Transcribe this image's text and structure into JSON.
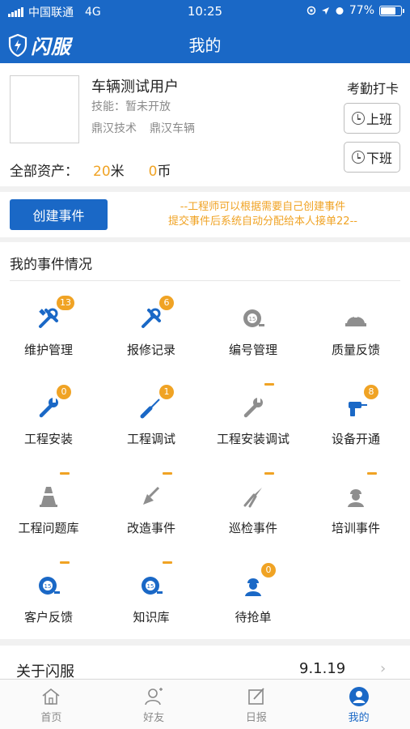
{
  "status_bar": {
    "carrier": "中国联通",
    "network": "4G",
    "time": "10:25",
    "battery": "77%",
    "battery_level": 0.77
  },
  "nav": {
    "logo_text": "闪服",
    "title": "我的"
  },
  "profile": {
    "name": "车辆测试用户",
    "skill": "技能：暂未开放",
    "orgs": [
      "鼎汉技术",
      "鼎汉车辆"
    ],
    "assets_label": "全部资产：",
    "meters_value": "20",
    "meters_unit": "米",
    "coins_value": "0",
    "coins_unit": "币",
    "attendance_label": "考勤打卡",
    "punch_in": "上班",
    "punch_out": "下班"
  },
  "create": {
    "button": "创建事件",
    "tip1": "--工程师可以根据需要自己创建事件",
    "tip2": "提交事件后系统自动分配给本人接单22--"
  },
  "events": {
    "title": "我的事件情况",
    "items": [
      {
        "label": "维护管理",
        "badge": "13",
        "icon": "tools-icon"
      },
      {
        "label": "报修记录",
        "badge": "6",
        "icon": "repair-icon"
      },
      {
        "label": "编号管理",
        "badge": "",
        "icon": "tape-measure-icon"
      },
      {
        "label": "质量反馈",
        "badge": "",
        "icon": "helmet-icon"
      },
      {
        "label": "工程安装",
        "badge": "0",
        "icon": "wrench-icon"
      },
      {
        "label": "工程调试",
        "badge": "1",
        "icon": "screwdriver-icon"
      },
      {
        "label": "工程安装调试",
        "badge": "—",
        "icon": "wrench-gray-icon"
      },
      {
        "label": "设备开通",
        "badge": "8",
        "icon": "drill-icon"
      },
      {
        "label": "工程问题库",
        "badge": "—",
        "icon": "cone-icon"
      },
      {
        "label": "改造事件",
        "badge": "—",
        "icon": "shovel-icon"
      },
      {
        "label": "巡检事件",
        "badge": "—",
        "icon": "pliers-icon"
      },
      {
        "label": "培训事件",
        "badge": "—",
        "icon": "worker-icon"
      },
      {
        "label": "客户反馈",
        "badge": "—",
        "icon": "tape-blue-icon"
      },
      {
        "label": "知识库",
        "badge": "—",
        "icon": "tape-blue-icon"
      },
      {
        "label": "待抢单",
        "badge": "0",
        "icon": "engineer-icon"
      }
    ]
  },
  "about": {
    "label": "关于闪服",
    "version": "9.1.19"
  },
  "tabbar": {
    "items": [
      {
        "label": "首页",
        "icon": "home-icon"
      },
      {
        "label": "好友",
        "icon": "friend-icon"
      },
      {
        "label": "日报",
        "icon": "report-icon"
      },
      {
        "label": "我的",
        "icon": "profile-icon"
      }
    ]
  },
  "colors": {
    "brand_blue": "#1a68c6",
    "accent_orange": "#f0a324"
  }
}
